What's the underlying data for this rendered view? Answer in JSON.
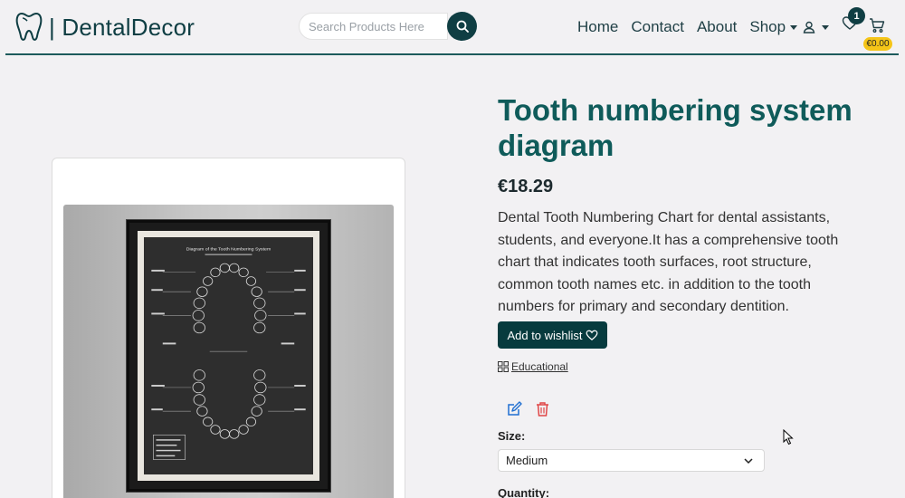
{
  "header": {
    "brand": "| DentalDecor",
    "search_placeholder": "Search Products Here",
    "nav": {
      "home": "Home",
      "contact": "Contact",
      "about": "About",
      "shop": "Shop"
    },
    "wishlist_count": "1",
    "cart_total": "€0.00"
  },
  "product": {
    "title": "Tooth numbering system diagram",
    "price": "€18.29",
    "description": "Dental Tooth Numbering Chart for dental assistants, students, and everyone.It has a comprehensive tooth chart that indicates tooth surfaces, root structure, common tooth names etc. in addition to the tooth numbers for primary and secondary dentition.",
    "wishlist_button": "Add to wishlist",
    "category": "Educational",
    "size_label": "Size:",
    "size_value": "Medium",
    "quantity_label": "Quantity:",
    "poster_title": "Diagram of the Tooth Numbering System"
  },
  "colors": {
    "brand": "#0f3e43",
    "title": "#0f5b5a",
    "badge": "#f5c518",
    "delete": "#e04646",
    "edit": "#1f6fd1"
  }
}
